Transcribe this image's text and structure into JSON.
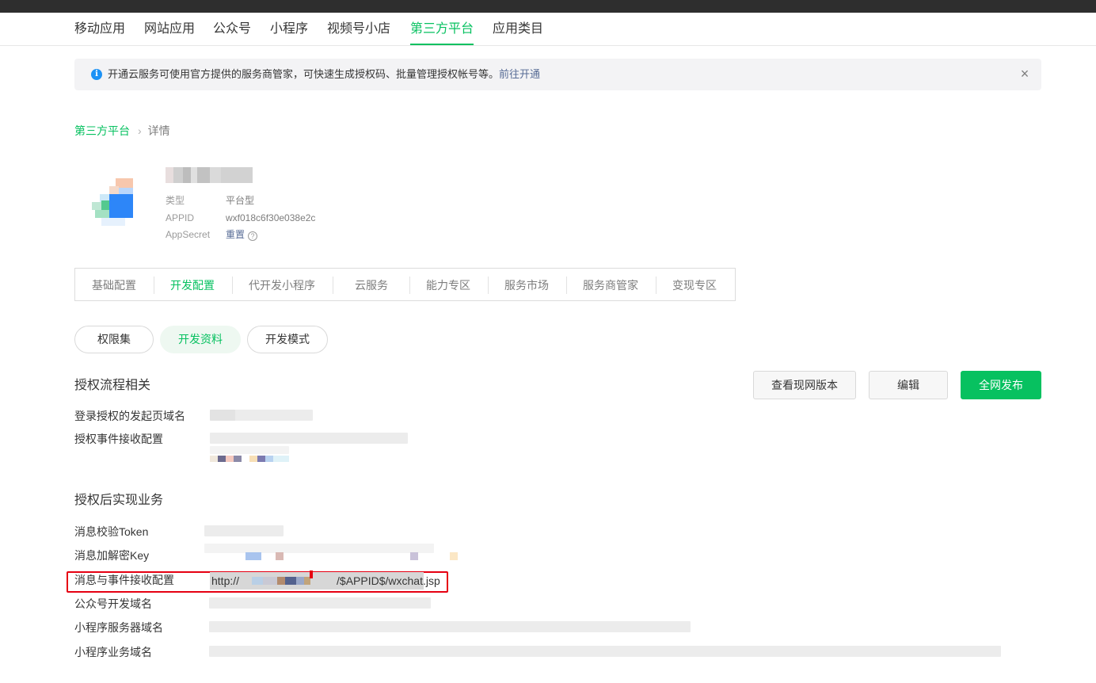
{
  "top_nav": {
    "tabs": [
      {
        "label": "移动应用",
        "active": false
      },
      {
        "label": "网站应用",
        "active": false
      },
      {
        "label": "公众号",
        "active": false
      },
      {
        "label": "小程序",
        "active": false
      },
      {
        "label": "视频号小店",
        "active": false
      },
      {
        "label": "第三方平台",
        "active": true
      },
      {
        "label": "应用类目",
        "active": false
      }
    ]
  },
  "notice": {
    "icon": "info-icon",
    "text": "开通云服务可使用官方提供的服务商管家，可快速生成授权码、批量管理授权帐号等。",
    "link": "前往开通",
    "close_icon": "close-icon"
  },
  "breadcrumb": {
    "root": "第三方平台",
    "separator": "›",
    "current": "详情"
  },
  "app": {
    "type_label": "类型",
    "type_value": "平台型",
    "appid_label": "APPID",
    "appid_value": "wxf018c6f30e038e2c",
    "secret_label": "AppSecret",
    "secret_action": "重置",
    "help_icon": "?"
  },
  "sub_tabs": [
    {
      "label": "基础配置",
      "active": false
    },
    {
      "label": "开发配置",
      "active": true
    },
    {
      "label": "代开发小程序",
      "active": false
    },
    {
      "label": "云服务",
      "active": false
    },
    {
      "label": "能力专区",
      "active": false
    },
    {
      "label": "服务市场",
      "active": false
    },
    {
      "label": "服务商管家",
      "active": false
    },
    {
      "label": "变现专区",
      "active": false
    }
  ],
  "pills": [
    {
      "label": "权限集",
      "active": false
    },
    {
      "label": "开发资料",
      "active": true
    },
    {
      "label": "开发模式",
      "active": false
    }
  ],
  "section_auth": {
    "title": "授权流程相关",
    "rows": [
      {
        "label": "登录授权的发起页域名"
      },
      {
        "label": "授权事件接收配置"
      }
    ]
  },
  "actions": {
    "view_current": "查看现网版本",
    "edit": "编辑",
    "publish": "全网发布"
  },
  "section_business": {
    "title": "授权后实现业务",
    "rows": [
      {
        "label": "消息校验Token"
      },
      {
        "label": "消息加解密Key"
      },
      {
        "label": "消息与事件接收配置",
        "value_prefix": "http://",
        "value_suffix": "/$APPID$/wxchat.jsp"
      },
      {
        "label": "公众号开发域名"
      },
      {
        "label": "小程序服务器域名"
      },
      {
        "label": "小程序业务域名"
      }
    ]
  },
  "colors": {
    "accent": "#07c160",
    "link": "#576b95",
    "highlight": "#e60012",
    "topbar": "#2e2e2e"
  }
}
